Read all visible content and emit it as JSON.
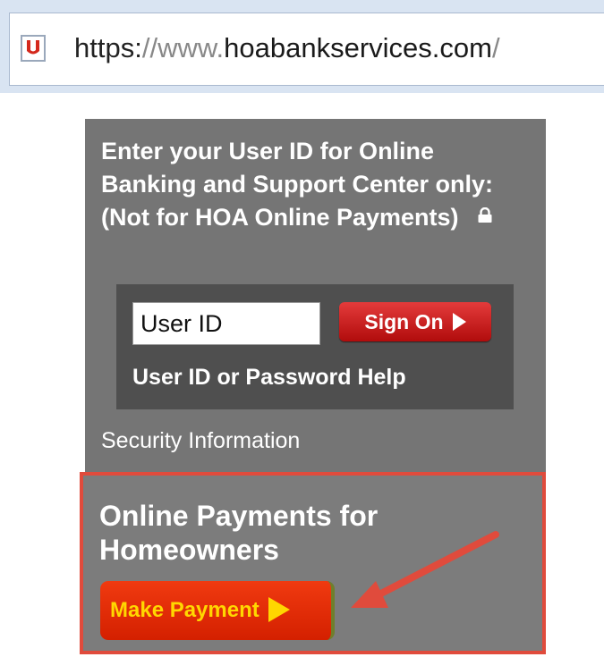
{
  "address_bar": {
    "url_scheme": "https:",
    "url_sep": "//",
    "url_www": "www.",
    "url_domain": "hoabankservices.com",
    "url_slash": "/",
    "site_icon": "shield-u-icon"
  },
  "login": {
    "heading": "Enter your User ID for Online Banking and Support Center only: (Not for HOA Online Payments)",
    "lock_icon": "lock-icon",
    "userid_placeholder": "User ID",
    "sign_on_label": "Sign On",
    "help_link": "User ID or Password Help",
    "security_link": "Security Information"
  },
  "payments": {
    "title": "Online Payments for Homeowners",
    "button_label": "Make Payment"
  },
  "colors": {
    "panel": "#757575",
    "inner_panel": "#4f4f4f",
    "sign_on": "#c81d1d",
    "make_payment": "#e52e0a",
    "highlight": "#e04b3c"
  }
}
